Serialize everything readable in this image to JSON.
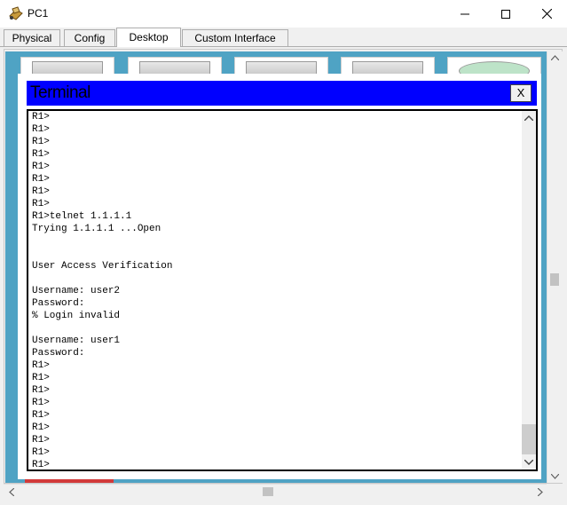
{
  "window": {
    "title": "PC1",
    "icons": {
      "app": "pc-app-icon",
      "minimize": "minimize-icon",
      "maximize": "maximize-icon",
      "close": "close-icon"
    }
  },
  "tabs": [
    {
      "label": "Physical",
      "active": false
    },
    {
      "label": "Config",
      "active": false
    },
    {
      "label": "Desktop",
      "active": true
    },
    {
      "label": "Custom Interface",
      "active": false
    }
  ],
  "terminal": {
    "title": "Terminal",
    "close_label": "X",
    "lines": [
      "R1>",
      "R1>",
      "R1>",
      "R1>",
      "R1>",
      "R1>",
      "R1>",
      "R1>",
      "R1>telnet 1.1.1.1",
      "Trying 1.1.1.1 ...Open",
      "",
      "",
      "User Access Verification",
      "",
      "Username: user2",
      "Password:",
      "% Login invalid",
      "",
      "Username: user1",
      "Password:",
      "R1>",
      "R1>",
      "R1>",
      "R1>",
      "R1>",
      "R1>",
      "R1>",
      "R1>",
      "R1>",
      "R1>"
    ]
  },
  "colors": {
    "terminal_header": "#0000ff",
    "desktop_background": "#4fa3c4"
  }
}
